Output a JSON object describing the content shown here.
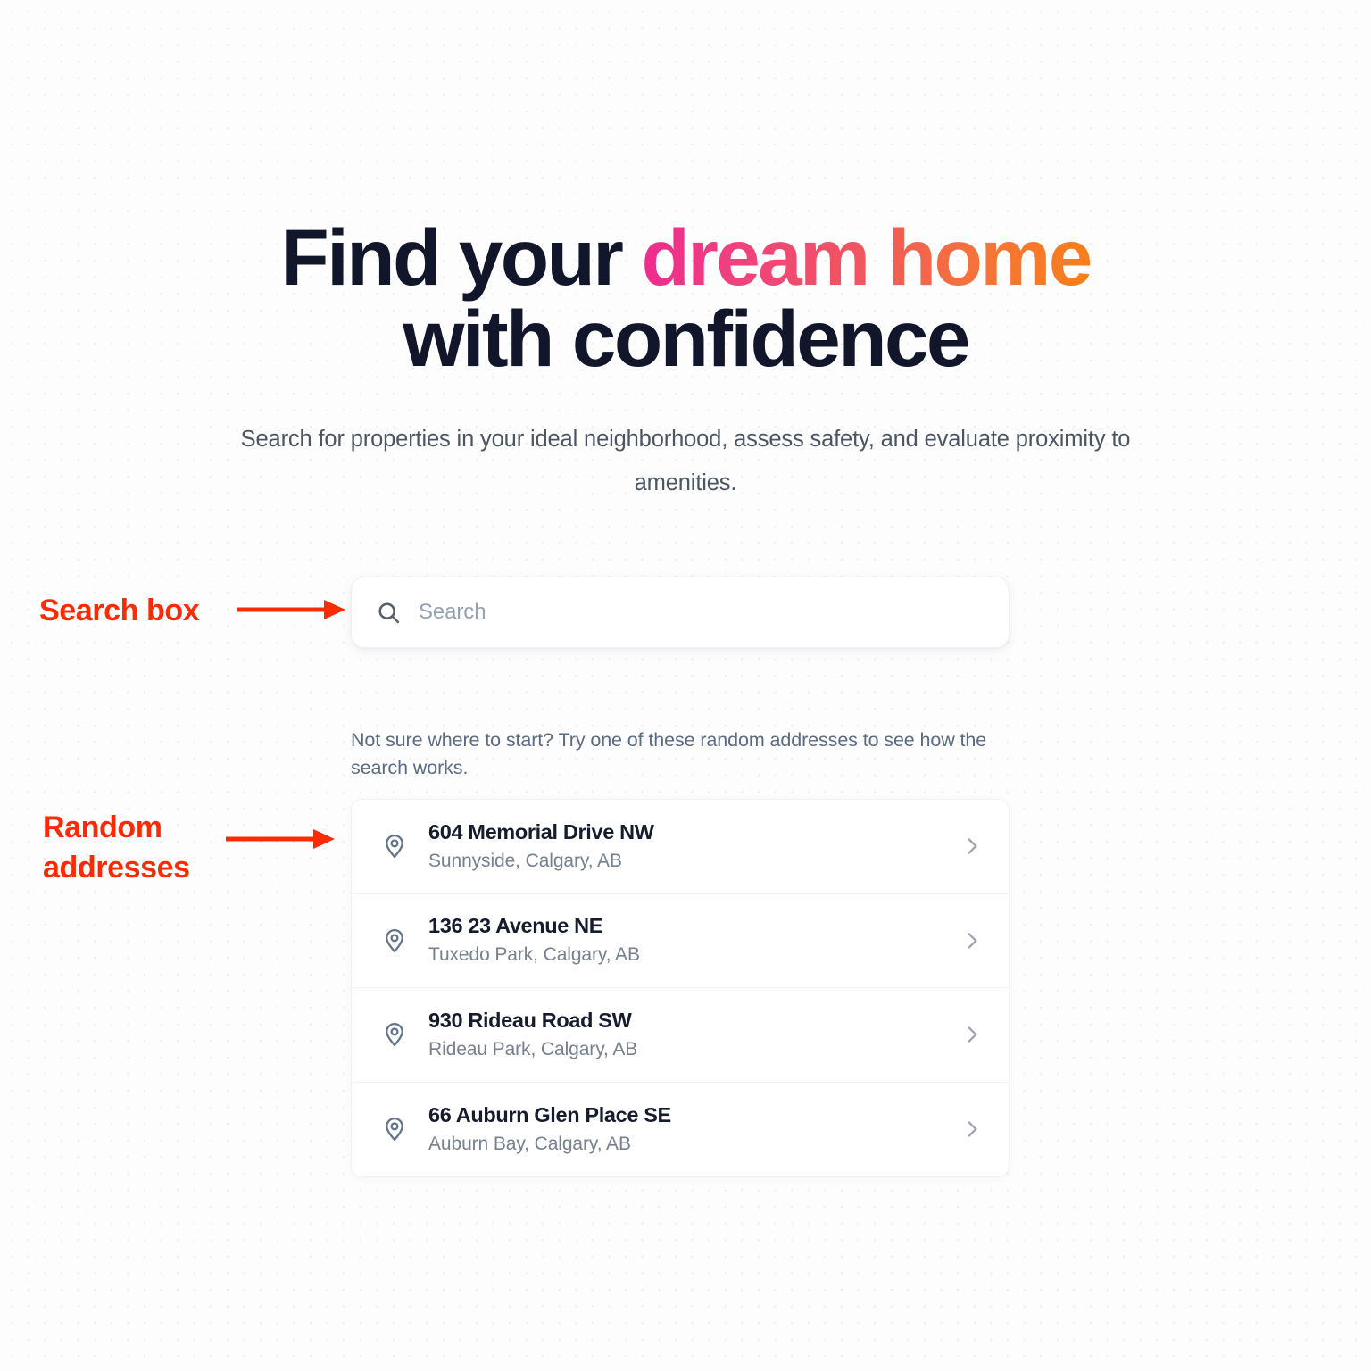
{
  "hero": {
    "headline_part1": "Find your ",
    "headline_gradient": "dream home",
    "headline_line2": "with confidence",
    "subtitle": "Search for properties in your ideal neighborhood, assess safety, and evaluate proximity to amenities."
  },
  "search": {
    "placeholder": "Search",
    "value": "",
    "icon": "search-icon"
  },
  "suggestions": {
    "helper_text": "Not sure where to start? Try one of these random addresses to see how the search works.",
    "items": [
      {
        "title": "604 Memorial Drive NW",
        "subtitle": "Sunnyside, Calgary, AB",
        "icon": "map-pin-icon",
        "chevron": "chevron-right-icon"
      },
      {
        "title": "136 23 Avenue NE",
        "subtitle": "Tuxedo Park, Calgary, AB",
        "icon": "map-pin-icon",
        "chevron": "chevron-right-icon"
      },
      {
        "title": "930 Rideau Road SW",
        "subtitle": "Rideau Park, Calgary, AB",
        "icon": "map-pin-icon",
        "chevron": "chevron-right-icon"
      },
      {
        "title": "66 Auburn Glen Place SE",
        "subtitle": "Auburn Bay, Calgary, AB",
        "icon": "map-pin-icon",
        "chevron": "chevron-right-icon"
      }
    ]
  },
  "annotations": {
    "search_box_label": "Search box",
    "random_addresses_label_line1": "Random",
    "random_addresses_label_line2": "addresses",
    "color": "#fb2b06"
  },
  "colors": {
    "headline_dark": "#12162a",
    "gradient_start": "#ee2a8e",
    "gradient_end": "#f97f18",
    "subtitle": "#4b5563",
    "helper_text": "#5b6b84",
    "address_title": "#161b2e",
    "address_subtitle": "#76808f",
    "pin_icon": "#64748b",
    "chevron_icon": "#9aa3b2",
    "search_icon": "#565d6b",
    "placeholder": "#98a1b3",
    "page_background": "#fdfdfe",
    "dot_grid": "#eceaee",
    "card_background": "#ffffff",
    "divider": "#f1f2f5"
  }
}
